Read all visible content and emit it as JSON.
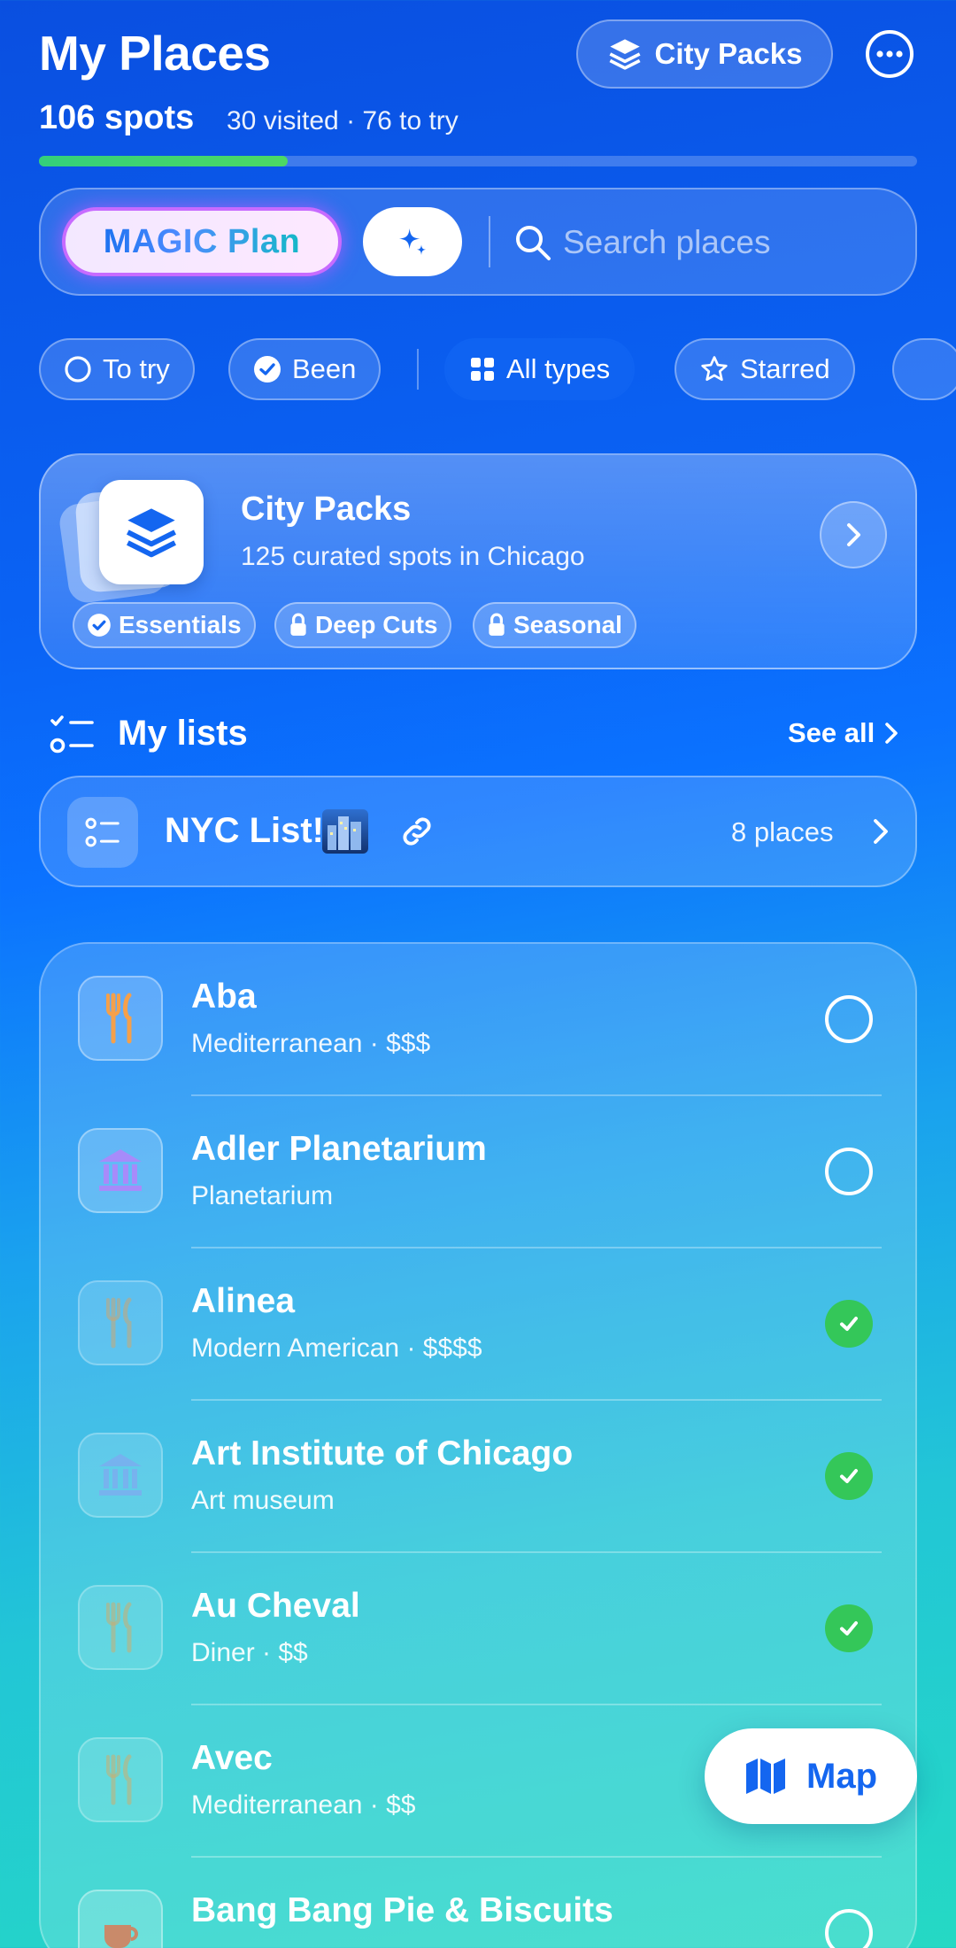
{
  "header": {
    "title": "My Places",
    "city_packs_label": "City Packs",
    "spots": "106 spots",
    "spots_sub": "30 visited · 76 to try",
    "progress_visited": 30,
    "progress_total": 106
  },
  "search": {
    "magic_label": "MAGIC Plan",
    "placeholder": "Search places"
  },
  "filters": [
    {
      "label": "To try",
      "icon": "circle-icon"
    },
    {
      "label": "Been",
      "icon": "check-circle-icon"
    },
    {
      "label": "All types",
      "icon": "grid-icon",
      "active": true
    },
    {
      "label": "Starred",
      "icon": "star-icon"
    }
  ],
  "city_pack": {
    "title": "City Packs",
    "subtitle": "125 curated spots in Chicago",
    "tags": [
      "Essentials",
      "Deep Cuts",
      "Seasonal"
    ]
  },
  "lists": {
    "title": "My lists",
    "see_all": "See all",
    "items": [
      {
        "name": "NYC List!",
        "emoji": "city-skyline-emoji",
        "count": "8 places"
      }
    ]
  },
  "places": [
    {
      "name": "Aba",
      "sub": "Mediterranean · $$$",
      "icon": "fork-knife-icon",
      "visited": false
    },
    {
      "name": "Adler Planetarium",
      "sub": "Planetarium",
      "icon": "museum-icon",
      "visited": false
    },
    {
      "name": "Alinea",
      "sub": "Modern American · $$$$",
      "icon": "fork-knife-icon",
      "visited": true
    },
    {
      "name": "Art Institute of Chicago",
      "sub": "Art museum",
      "icon": "museum-icon",
      "visited": true
    },
    {
      "name": "Au Cheval",
      "sub": "Diner · $$",
      "icon": "fork-knife-icon",
      "visited": true
    },
    {
      "name": "Avec",
      "sub": "Mediterranean · $$",
      "icon": "fork-knife-icon",
      "visited": null
    },
    {
      "name": "Bang Bang Pie & Biscuits",
      "sub": "",
      "icon": "coffee-cup-icon",
      "visited": false
    }
  ],
  "map_button": {
    "label": "Map"
  },
  "colors": {
    "accent": "#0f63f2",
    "visited_green": "#34c759",
    "progress_green": "#34d07a",
    "restaurant_orange": "#f5a04a",
    "museum_purple": "#a78bfa"
  }
}
